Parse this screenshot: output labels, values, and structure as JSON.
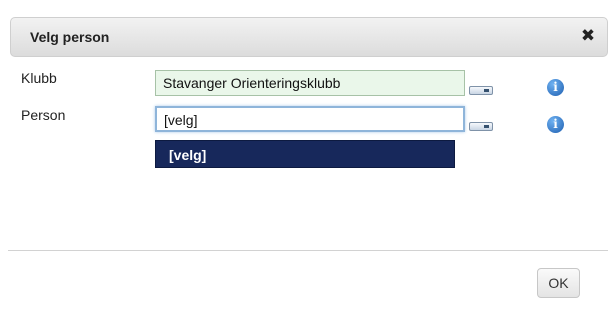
{
  "dialog": {
    "title": "Velg person",
    "close_glyph": "✖",
    "close_icon": "close-icon"
  },
  "form": {
    "club_label": "Klubb",
    "club_value": "Stavanger Orienteringsklubb",
    "person_label": "Person",
    "person_value": "[velg]",
    "info_glyph": "i"
  },
  "dropdown": {
    "options": [
      "[velg]"
    ],
    "highlight_color": "#17285b"
  },
  "footer": {
    "ok_label": "OK"
  }
}
